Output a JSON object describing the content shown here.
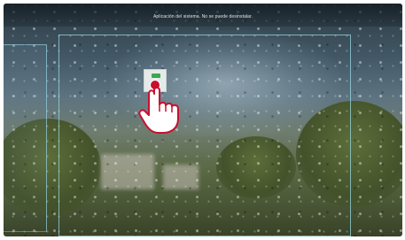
{
  "header": {
    "system_message": "Aplicación del sistema. No se puede desinstalar."
  },
  "desktop": {
    "app_tile_icon": "app-icon",
    "tap_indicator_icon": "tap-dot-icon",
    "gesture_icon": "hand-pointer-icon"
  },
  "colors": {
    "accent_frame": "#96d7e1",
    "tap_dot": "#c8102e",
    "app_flag": "#39a852"
  }
}
